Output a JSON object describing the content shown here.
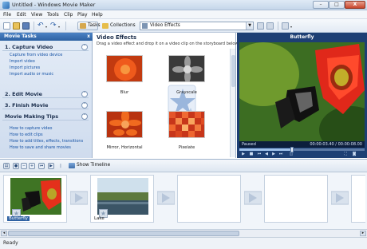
{
  "window": {
    "title": "Untitled - Windows Movie Maker",
    "minimize": "–",
    "maximize": "□",
    "close": "X"
  },
  "menu": [
    "File",
    "Edit",
    "View",
    "Tools",
    "Clip",
    "Play",
    "Help"
  ],
  "toolbar": {
    "tasks_label": "Tasks",
    "collections_label": "Collections",
    "collection_combo": "Video Effects"
  },
  "task_pane": {
    "header": "Movie Tasks",
    "close": "x",
    "sections": [
      {
        "title": "1. Capture Video",
        "links": [
          "Capture from video device",
          "Import video",
          "Import pictures",
          "Import audio or music"
        ]
      },
      {
        "title": "2. Edit Movie",
        "links": []
      },
      {
        "title": "3. Finish Movie",
        "links": []
      },
      {
        "title": "Movie Making Tips",
        "links": [
          "How to capture video",
          "How to edit clips",
          "How to add titles, effects, transitions",
          "How to save and share movies"
        ]
      }
    ]
  },
  "effects_panel": {
    "title": "Video Effects",
    "description": "Drag a video effect and drop it on a video clip on the storyboard below.",
    "effects": [
      {
        "name": "Blur",
        "icon": "flower-blur-thumb"
      },
      {
        "name": "Grayscale",
        "icon": "flower-grayscale-thumb"
      },
      {
        "name": "Mirror, Horizontal",
        "icon": "flower-mirror-thumb"
      },
      {
        "name": "Pixelate",
        "icon": "flower-pixelate-thumb"
      }
    ]
  },
  "monitor": {
    "title": "Butterfly",
    "status": "Paused",
    "time": "00:00:03.40 / 00:00:08.00"
  },
  "storyboard_toolbar": {
    "show_timeline": "Show Timeline"
  },
  "storyboard": {
    "clips": [
      {
        "label": "Butterfly",
        "selected": true
      },
      {
        "label": "Lake",
        "selected": false
      }
    ]
  },
  "status_bar": {
    "text": "Ready"
  },
  "colors": {
    "accent": "#2e61a2",
    "link": "#1552a5",
    "monitor_bg": "#1d3f74"
  }
}
